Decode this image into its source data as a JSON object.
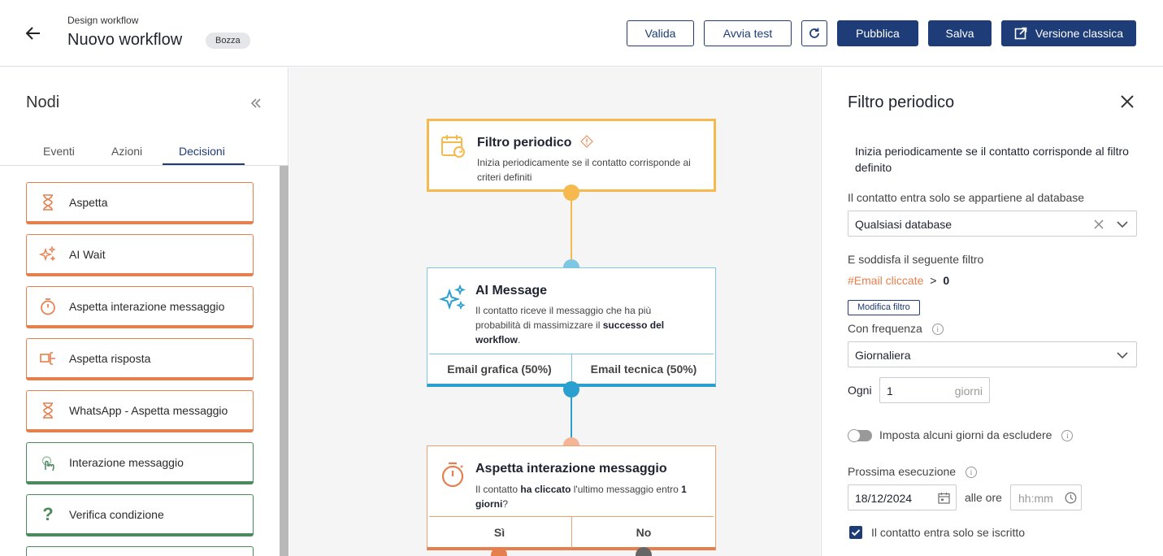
{
  "header": {
    "subtitle": "Design workflow",
    "title": "Nuovo workflow",
    "badge": "Bozza",
    "buttons": {
      "valida": "Valida",
      "avvia_test": "Avvia test",
      "pubblica": "Pubblica",
      "salva": "Salva",
      "versione_classica": "Versione classica"
    }
  },
  "left_panel": {
    "title": "Nodi",
    "tabs": [
      "Eventi",
      "Azioni",
      "Decisioni"
    ],
    "active_tab": "Decisioni",
    "items": [
      {
        "label": "Aspetta",
        "icon": "hourglass-icon",
        "color": "orange"
      },
      {
        "label": "AI Wait",
        "icon": "sparkles-icon",
        "color": "orange"
      },
      {
        "label": "Aspetta interazione messaggio",
        "icon": "stopwatch-icon",
        "color": "orange"
      },
      {
        "label": "Aspetta risposta",
        "icon": "reply-wait-icon",
        "color": "orange"
      },
      {
        "label": "WhatsApp - Aspetta messaggio",
        "icon": "hourglass-icon",
        "color": "orange"
      },
      {
        "label": "Interazione messaggio",
        "icon": "touch-icon",
        "color": "green"
      },
      {
        "label": "Verifica condizione",
        "icon": "question-icon",
        "color": "green"
      }
    ]
  },
  "canvas": {
    "node1": {
      "title": "Filtro periodico",
      "desc": "Inizia periodicamente se il contatto corrisponde ai criteri definiti"
    },
    "node2": {
      "title": "AI Message",
      "desc_a": "Il contatto riceve il messaggio che ha più probabilità di massimizzare il ",
      "desc_b": "successo del workflow",
      "desc_c": ".",
      "branch_left": "Email grafica (50%)",
      "branch_right": "Email tecnica (50%)"
    },
    "node3": {
      "title": "Aspetta interazione messaggio",
      "desc_a": "Il contatto ",
      "desc_b": "ha cliccato",
      "desc_c": " l'ultimo messaggio entro ",
      "desc_d": "1 giorni",
      "desc_e": "?",
      "branch_left": "Sì",
      "branch_right": "No"
    }
  },
  "right_panel": {
    "title": "Filtro periodico",
    "description": "Inizia periodicamente se il contatto corrisponde al filtro definito",
    "db_label": "Il contatto entra solo se appartiene al database",
    "db_value": "Qualsiasi database",
    "filter_label": "E soddisfa il seguente filtro",
    "filter_field": "#Email cliccate",
    "filter_op": ">",
    "filter_value": "0",
    "edit_filter": "Modifica filtro",
    "frequency_label": "Con frequenza",
    "frequency_value": "Giornaliera",
    "every_label": "Ogni",
    "every_value": "1",
    "every_unit": "giorni",
    "exclude_label": "Imposta alcuni giorni da escludere",
    "next_label": "Prossima esecuzione",
    "next_date": "18/12/2024",
    "at_label": "alle ore",
    "time_placeholder": "hh:mm",
    "subscribed_label": "Il contatto entra solo se iscritto",
    "subscribed_checked": true
  },
  "colors": {
    "primary": "#1d3c78",
    "orange": "#e67f4e",
    "green": "#4a8a5c",
    "node_yellow": "#f5b94e",
    "node_blue": "#2a9fd0",
    "node_orange": "#f0a070"
  }
}
